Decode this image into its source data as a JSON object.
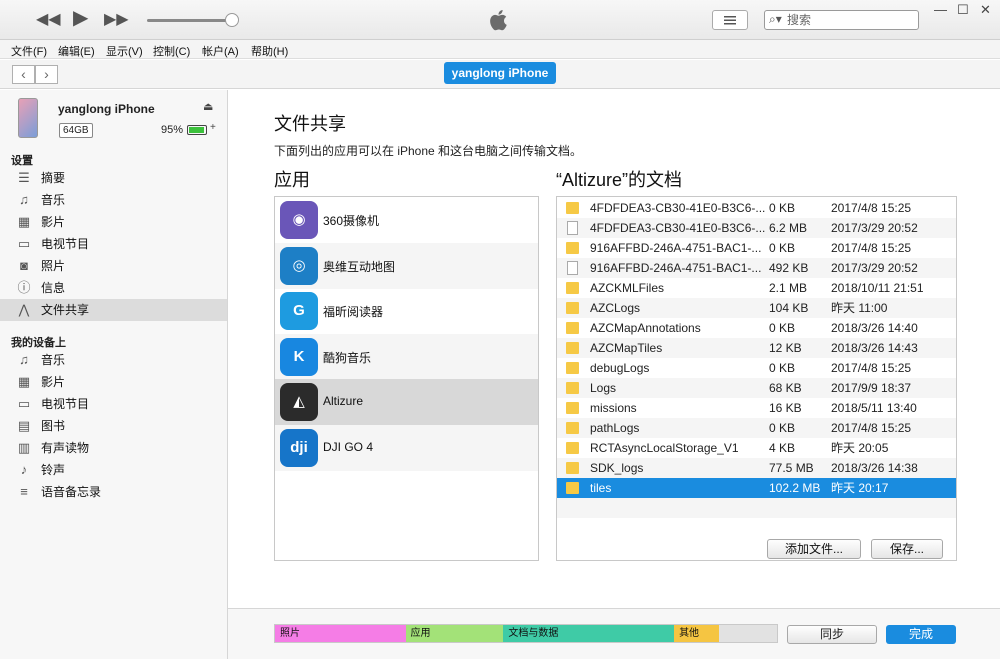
{
  "toolbar": {
    "rewind_icon": "rewind-icon",
    "play_icon": "play-icon",
    "forward_icon": "fast-forward-icon",
    "search_placeholder": "搜索"
  },
  "menu": [
    "文件(F)",
    "编辑(E)",
    "显示(V)",
    "控制(C)",
    "帐户(A)",
    "帮助(H)"
  ],
  "navbar": {
    "device_button": "yanglong iPhone"
  },
  "device": {
    "name": "yanglong iPhone",
    "capacity": "64GB",
    "battery_percent": "95%",
    "battery_level": 0.95
  },
  "sidebar": {
    "settings_title": "设置",
    "settings_items": [
      {
        "label": "摘要",
        "icon": "summary-icon"
      },
      {
        "label": "音乐",
        "icon": "music-icon"
      },
      {
        "label": "影片",
        "icon": "film-icon"
      },
      {
        "label": "电视节目",
        "icon": "tv-icon"
      },
      {
        "label": "照片",
        "icon": "camera-icon"
      },
      {
        "label": "信息",
        "icon": "info-icon"
      },
      {
        "label": "文件共享",
        "icon": "apps-icon"
      }
    ],
    "mydevice_title": "我的设备上",
    "device_items": [
      {
        "label": "音乐",
        "icon": "music-icon"
      },
      {
        "label": "影片",
        "icon": "film-icon"
      },
      {
        "label": "电视节目",
        "icon": "tv-icon"
      },
      {
        "label": "图书",
        "icon": "book-icon"
      },
      {
        "label": "有声读物",
        "icon": "audiobook-icon"
      },
      {
        "label": "铃声",
        "icon": "bell-icon"
      },
      {
        "label": "语音备忘录",
        "icon": "voice-memo-icon"
      }
    ]
  },
  "main": {
    "title": "文件共享",
    "description": "下面列出的应用可以在 iPhone 和这台电脑之间传输文档。",
    "apps_heading": "应用",
    "docs_heading": "“Altizure”的文档"
  },
  "apps": [
    {
      "name": "360摄像机",
      "color": "#6a56b8",
      "glyph": "◉"
    },
    {
      "name": "奥维互动地图",
      "color": "#1d7fc6",
      "glyph": "◎"
    },
    {
      "name": "福昕阅读器",
      "color": "#1e9be0",
      "glyph": "G"
    },
    {
      "name": "酷狗音乐",
      "color": "#1887e0",
      "glyph": "K"
    },
    {
      "name": "Altizure",
      "color": "#2b2b2b",
      "glyph": "◭"
    },
    {
      "name": "DJI GO 4",
      "color": "#1675c9",
      "glyph": "dji"
    }
  ],
  "documents": [
    {
      "name": "4FDFDEA3-CB30-41E0-B3C6-...",
      "size": "0 KB",
      "date": "2017/4/8 15:25",
      "type": "folder"
    },
    {
      "name": "4FDFDEA3-CB30-41E0-B3C6-...",
      "size": "6.2 MB",
      "date": "2017/3/29 20:52",
      "type": "file"
    },
    {
      "name": "916AFFBD-246A-4751-BAC1-...",
      "size": "0 KB",
      "date": "2017/4/8 15:25",
      "type": "folder"
    },
    {
      "name": "916AFFBD-246A-4751-BAC1-...",
      "size": "492 KB",
      "date": "2017/3/29 20:52",
      "type": "file"
    },
    {
      "name": "AZCKMLFiles",
      "size": "2.1 MB",
      "date": "2018/10/11 21:51",
      "type": "folder"
    },
    {
      "name": "AZCLogs",
      "size": "104 KB",
      "date": "昨天 11:00",
      "type": "folder"
    },
    {
      "name": "AZCMapAnnotations",
      "size": "0 KB",
      "date": "2018/3/26 14:40",
      "type": "folder"
    },
    {
      "name": "AZCMapTiles",
      "size": "12 KB",
      "date": "2018/3/26 14:43",
      "type": "folder"
    },
    {
      "name": "debugLogs",
      "size": "0 KB",
      "date": "2017/4/8 15:25",
      "type": "folder"
    },
    {
      "name": "Logs",
      "size": "68 KB",
      "date": "2017/9/9 18:37",
      "type": "folder"
    },
    {
      "name": "missions",
      "size": "16 KB",
      "date": "2018/5/11 13:40",
      "type": "folder"
    },
    {
      "name": "pathLogs",
      "size": "0 KB",
      "date": "2017/4/8 15:25",
      "type": "folder"
    },
    {
      "name": "RCTAsyncLocalStorage_V1",
      "size": "4 KB",
      "date": "昨天 20:05",
      "type": "folder"
    },
    {
      "name": "SDK_logs",
      "size": "77.5 MB",
      "date": "2018/3/26 14:38",
      "type": "folder"
    },
    {
      "name": "tiles",
      "size": "102.2 MB",
      "date": "昨天 20:17",
      "type": "folder"
    }
  ],
  "doc_buttons": {
    "add": "添加文件...",
    "save": "保存..."
  },
  "storage": [
    {
      "label": "照片",
      "color": "#f57de6",
      "fraction": 0.26
    },
    {
      "label": "应用",
      "color": "#a3e278",
      "fraction": 0.195
    },
    {
      "label": "文档与数据",
      "color": "#3fcba6",
      "fraction": 0.34
    },
    {
      "label": "其他",
      "color": "#f5c542",
      "fraction": 0.09
    },
    {
      "label": "",
      "color": "#e2e2e2",
      "fraction": 0.115
    }
  ],
  "footer": {
    "sync": "同步",
    "done": "完成"
  }
}
